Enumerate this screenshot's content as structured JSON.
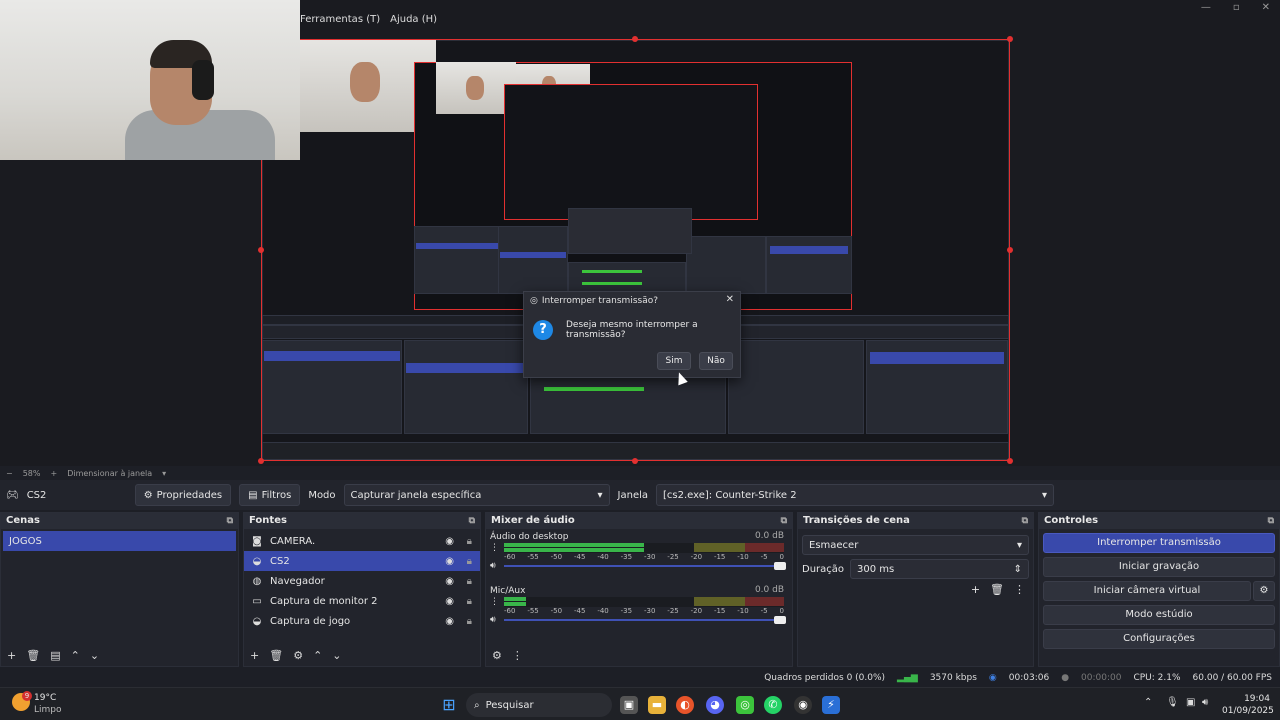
{
  "menu": {
    "tools": "Ferramentas (T)",
    "help": "Ajuda (H)"
  },
  "inner_dialog": {
    "title": "Interromper transmissão?",
    "message": "Deseja mesmo interromper a transmissão?",
    "yes": "Sim",
    "no": "Não"
  },
  "zoom": {
    "value": "58%",
    "label": "Dimensionar à janela"
  },
  "toolbar": {
    "source_name": "CS2",
    "properties": "Propriedades",
    "filters": "Filtros",
    "mode_label": "Modo",
    "mode_value": "Capturar janela específica",
    "window_label": "Janela",
    "window_value": "[cs2.exe]: Counter-Strike 2"
  },
  "scenes": {
    "title": "Cenas",
    "items": [
      "JOGOS"
    ]
  },
  "sources": {
    "title": "Fontes",
    "items": [
      "CAMERA.",
      "CS2",
      "Navegador",
      "Captura de monitor 2",
      "Captura de jogo"
    ]
  },
  "mixer": {
    "title": "Mixer de áudio",
    "channels": [
      {
        "name": "Áudio do desktop",
        "db": "0.0 dB"
      },
      {
        "name": "Mic/Aux",
        "db": "0.0 dB"
      }
    ],
    "ticks": [
      "-60",
      "-55",
      "-50",
      "-45",
      "-40",
      "-35",
      "-30",
      "-25",
      "-20",
      "-15",
      "-10",
      "-5",
      "0"
    ]
  },
  "transitions": {
    "title": "Transições de cena",
    "type": "Esmaecer",
    "duration_label": "Duração",
    "duration_value": "300 ms"
  },
  "controls": {
    "title": "Controles",
    "stop_stream": "Interromper transmissão",
    "start_recording": "Iniciar gravação",
    "virtual_cam": "Iniciar câmera virtual",
    "studio_mode": "Modo estúdio",
    "settings": "Configurações"
  },
  "status": {
    "dropped": "Quadros perdidos 0 (0.0%)",
    "bitrate": "3570 kbps",
    "stream_time": "00:03:06",
    "rec_time": "00:00:00",
    "cpu": "CPU: 2.1%",
    "fps": "60.00 / 60.00 FPS"
  },
  "taskbar": {
    "weather_temp": "19°C",
    "weather_desc": "Limpo",
    "weather_badge": "9",
    "search": "Pesquisar",
    "time": "19:04",
    "date": "01/09/2025"
  },
  "colors": {
    "accent": "#3949ab",
    "selection_border": "#e23030",
    "meter_green": "#39b54a"
  }
}
